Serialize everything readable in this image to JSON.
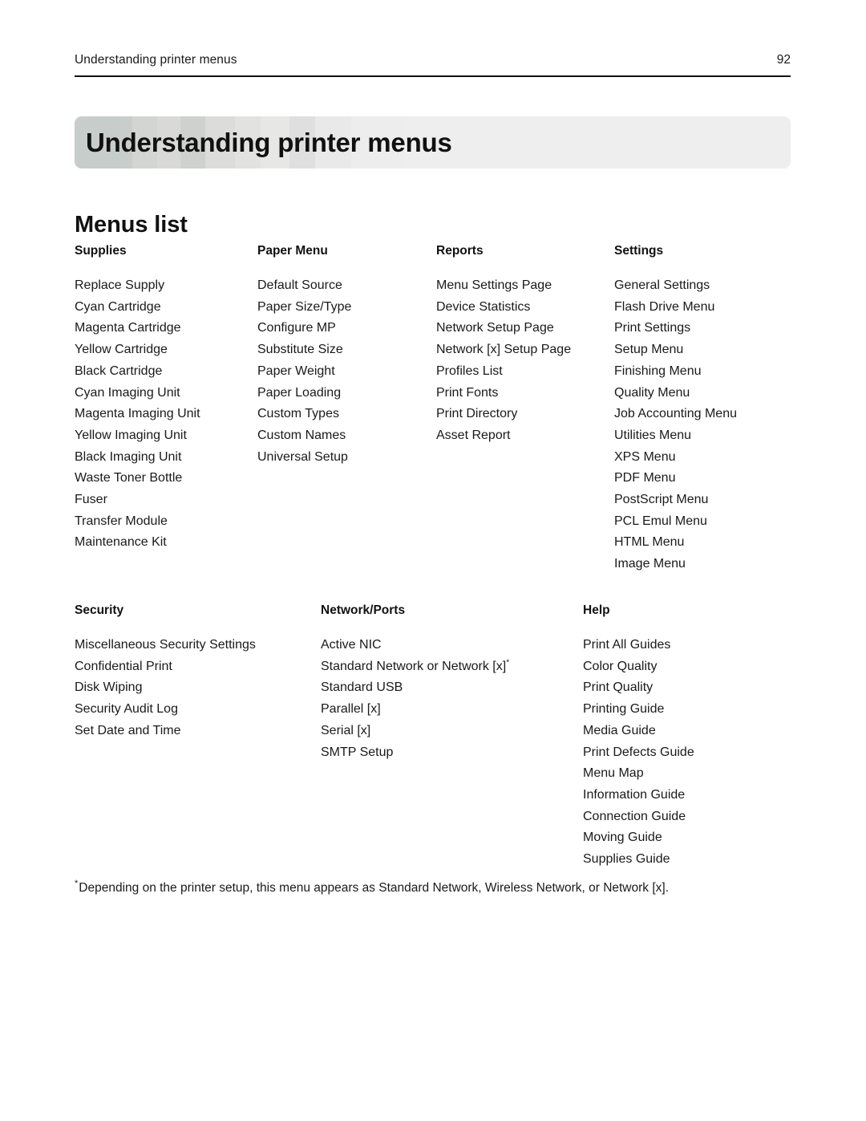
{
  "page": {
    "running_header": "Understanding printer menus",
    "page_number": "92",
    "chapter_title": "Understanding printer menus",
    "section_heading": "Menus list"
  },
  "menu_groups_row1": [
    {
      "title": "Supplies",
      "items": [
        "Replace Supply",
        "Cyan Cartridge",
        "Magenta Cartridge",
        "Yellow Cartridge",
        "Black Cartridge",
        "Cyan Imaging Unit",
        "Magenta Imaging Unit",
        "Yellow Imaging Unit",
        "Black Imaging Unit",
        "Waste Toner Bottle",
        "Fuser",
        "Transfer Module",
        "Maintenance Kit"
      ]
    },
    {
      "title": "Paper Menu",
      "items": [
        "Default Source",
        "Paper Size/Type",
        "Configure MP",
        "Substitute Size",
        "Paper Weight",
        "Paper Loading",
        "Custom Types",
        "Custom Names",
        "Universal Setup"
      ]
    },
    {
      "title": "Reports",
      "items": [
        "Menu Settings Page",
        "Device Statistics",
        "Network Setup Page",
        "Network [x] Setup Page",
        "Profiles List",
        "Print Fonts",
        "Print Directory",
        "Asset Report"
      ]
    },
    {
      "title": "Settings",
      "items": [
        "General Settings",
        "Flash Drive Menu",
        "Print Settings",
        "Setup Menu",
        "Finishing Menu",
        "Quality Menu",
        "Job Accounting Menu",
        "Utilities Menu",
        "XPS Menu",
        "PDF Menu",
        "PostScript Menu",
        "PCL Emul Menu",
        "HTML Menu",
        "Image Menu"
      ]
    }
  ],
  "menu_groups_row2": [
    {
      "title": "Security",
      "items": [
        "Miscellaneous Security Settings",
        "Confidential Print",
        "Disk Wiping",
        "Security Audit Log",
        "Set Date and Time"
      ]
    },
    {
      "title": "Network/Ports",
      "items": [
        "Active NIC",
        "Standard Network or Network [x]",
        "Standard USB",
        "Parallel [x]",
        "Serial [x]",
        "SMTP Setup"
      ],
      "footnote_item_index": 1,
      "footnote_marker": "*"
    },
    {
      "title": "Help",
      "items": [
        "Print All Guides",
        "Color Quality",
        "Print Quality",
        "Printing Guide",
        "Media Guide",
        "Print Defects Guide",
        "Menu Map",
        "Information Guide",
        "Connection Guide",
        "Moving Guide",
        "Supplies Guide"
      ]
    }
  ],
  "footnote": {
    "marker": "*",
    "text": "Depending on the printer setup, this menu appears as Standard Network, Wireless Network, or Network [x]."
  }
}
